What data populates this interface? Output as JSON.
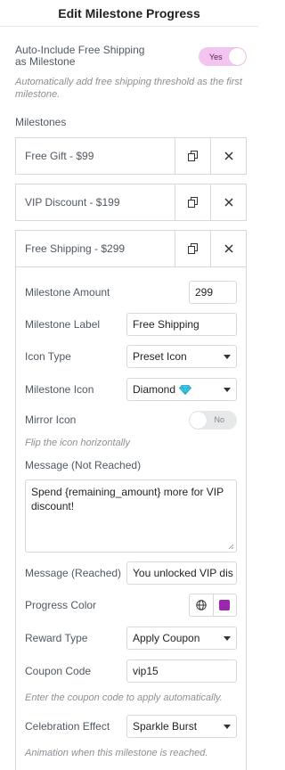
{
  "header": {
    "title": "Edit Milestone Progress"
  },
  "auto_include": {
    "label_line1": "Auto-Include Free Shipping",
    "label_line2": "as Milestone",
    "toggle": "Yes",
    "desc_line1": "Automatically add free shipping threshold as the first",
    "desc_line2": "milestone."
  },
  "milestones_heading": "Milestones",
  "milestones": [
    {
      "name": "Free Gift - $99"
    },
    {
      "name": "VIP Discount - $199"
    },
    {
      "name": "Free Shipping - $299"
    }
  ],
  "icons": {
    "duplicate": "copy-icon",
    "remove": "close-icon",
    "globe": "globe-icon",
    "diamond": "diamond-emoji"
  },
  "form": {
    "amount_label": "Milestone Amount",
    "amount_value": "299",
    "label_label": "Milestone Label",
    "label_value": "Free Shipping",
    "icon_type_label": "Icon Type",
    "icon_type_value": "Preset Icon",
    "milestone_icon_label": "Milestone Icon",
    "milestone_icon_value": "Diamond",
    "mirror_label": "Mirror Icon",
    "mirror_toggle": "No",
    "mirror_desc": "Flip the icon horizontally",
    "msg_not_reached_label": "Message (Not Reached)",
    "msg_not_reached_line1": "Spend {remaining_amount} more for VIP",
    "msg_not_reached_line2": "discount!",
    "msg_reached_label": "Message (Reached)",
    "msg_reached_value": "You unlocked VIP dis",
    "progress_color_label": "Progress Color",
    "reward_type_label": "Reward Type",
    "reward_type_value": "Apply Coupon",
    "coupon_label": "Coupon Code",
    "coupon_value": "vip15",
    "coupon_desc": "Enter the coupon code to apply automatically.",
    "celebration_label": "Celebration Effect",
    "celebration_value": "Sparkle Burst",
    "celebration_desc": "Animation when this milestone is reached."
  },
  "colors": {
    "swatch": "#9b27af",
    "toggle_on": "#f4c4f1",
    "border": "#d5d8dc",
    "diamond": "#41c7e8"
  }
}
